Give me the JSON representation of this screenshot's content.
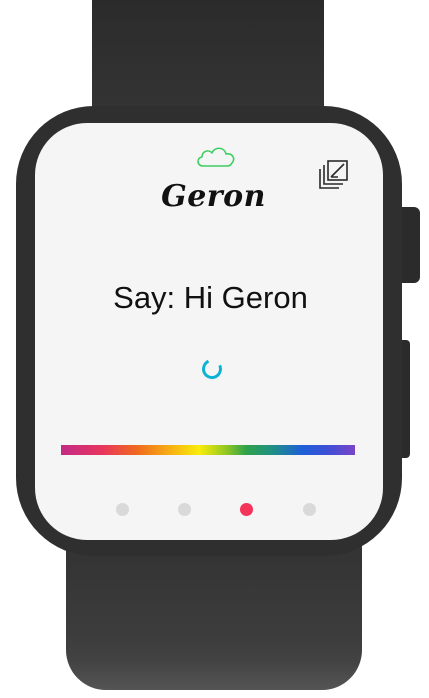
{
  "app": {
    "brand_title": "Geron",
    "prompt_text": "Say: Hi Geron"
  },
  "status": {
    "cloud_icon": "cloud-icon",
    "cloud_color": "#3ecf63",
    "spinner_color": "#0bb2d4"
  },
  "toolbar": {
    "gallery_icon": "gallery-icon"
  },
  "pager": {
    "count": 4,
    "active_index": 2,
    "active_color": "#f5345a",
    "inactive_color": "#d9d9d9"
  },
  "voice_bar": {
    "icon": "rainbow-gradient-bar"
  }
}
